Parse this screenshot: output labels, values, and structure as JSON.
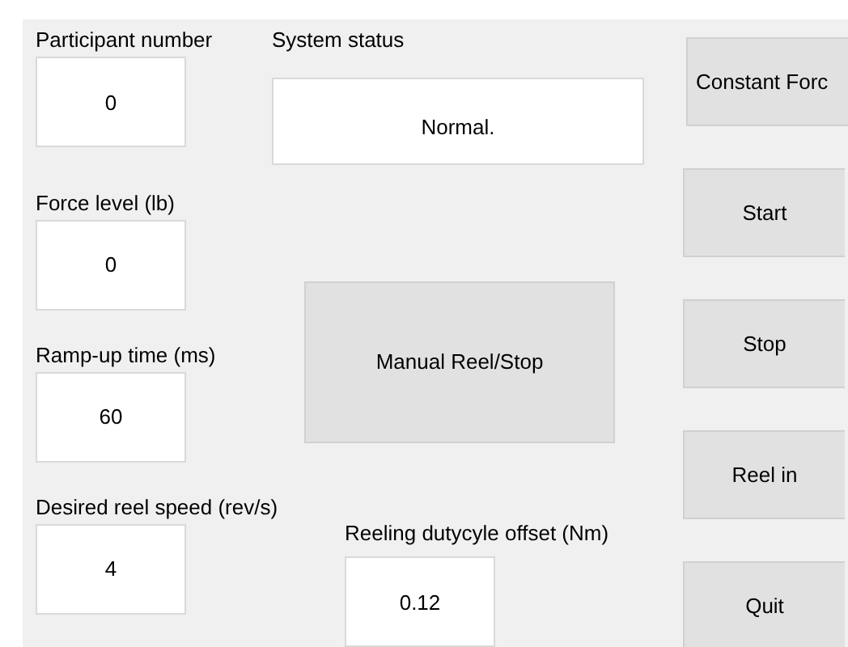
{
  "left_fields": [
    {
      "label": "Participant number",
      "value": "0"
    },
    {
      "label": "Force level (lb)",
      "value": "0"
    },
    {
      "label": "Ramp-up time (ms)",
      "value": "60"
    },
    {
      "label": "Desired reel speed (rev/s)",
      "value": "4"
    }
  ],
  "system_status": {
    "label": "System status",
    "value": "Normal."
  },
  "manual_button": "Manual Reel/Stop",
  "offset_field": {
    "label": "Reeling dutycyle offset (Nm)",
    "value": "0.12"
  },
  "side_buttons": [
    "Constant Forc",
    "Start",
    "Stop",
    "Reel in",
    "Quit"
  ]
}
